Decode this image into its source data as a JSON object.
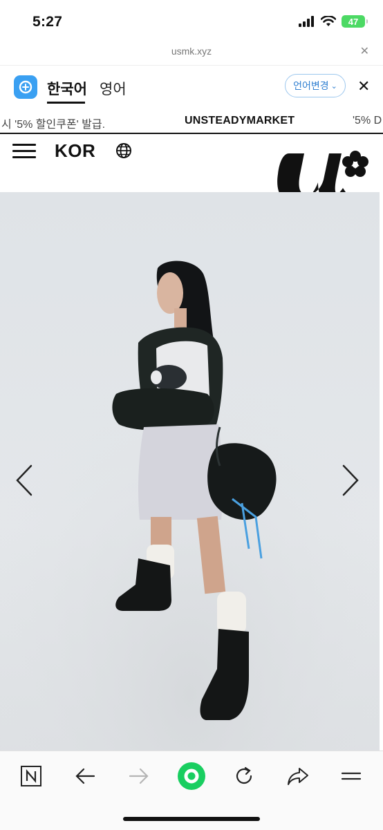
{
  "status_bar": {
    "time": "5:27",
    "battery": "47"
  },
  "browser": {
    "url": "usmk.xyz"
  },
  "translate_bar": {
    "source_lang": "한국어",
    "target_lang": "영어",
    "change_label": "언어변경"
  },
  "marquee": {
    "left_text": "시 '5% 할인쿠폰' 발급.",
    "center_text": "UNSTEADYMARKET",
    "right_text": "'5% D"
  },
  "site_header": {
    "region_label": "KOR"
  },
  "colors": {
    "accent_blue": "#3aa0f2",
    "naver_green": "#19ce60",
    "battery_green": "#4cd964"
  },
  "icons": [
    "menu-icon",
    "globe-icon",
    "brand-logo",
    "chevron-left-icon",
    "chevron-right-icon",
    "naver-n-icon",
    "back-icon",
    "forward-icon",
    "green-home-icon",
    "reload-icon",
    "share-icon",
    "more-menu-icon"
  ]
}
